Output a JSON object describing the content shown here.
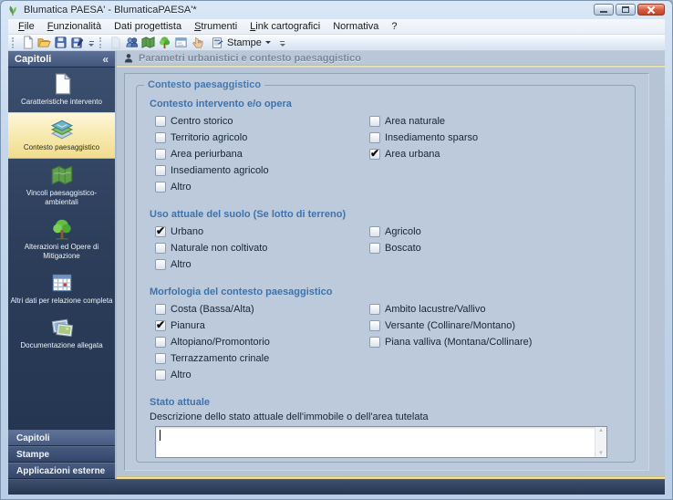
{
  "window": {
    "title": "Blumatica PAESA' - BlumaticaPAESA'*"
  },
  "menubar": {
    "items": [
      "File",
      "Funzionalità",
      "Dati progettista",
      "Strumenti",
      "Link cartografici",
      "Normativa",
      "?"
    ]
  },
  "toolbar": {
    "group1_icons": [
      "new-document-icon",
      "open-folder-icon",
      "save-icon",
      "save-as-icon"
    ],
    "group2_icons": [
      "disabled-document-icon",
      "users-icon",
      "green-map-icon",
      "tree-icon",
      "form-window-icon",
      "hand-icon"
    ],
    "stampe_label": "Stampe"
  },
  "sidebar": {
    "header": "Capitoli",
    "collapse_glyph": "«",
    "items": [
      {
        "label": "Caratteristiche intervento",
        "icon": "document-icon",
        "selected": false
      },
      {
        "label": "Contesto paesaggistico",
        "icon": "map-layers-icon",
        "selected": true
      },
      {
        "label": "Vincoli paesaggistico-ambientali",
        "icon": "green-map-icon",
        "selected": false
      },
      {
        "label": "Alterazioni ed Opere di Mitigazione",
        "icon": "tree-icon",
        "selected": false
      },
      {
        "label": "Altri dati per relazione completa",
        "icon": "table-icon",
        "selected": false
      },
      {
        "label": "Documentazione allegata",
        "icon": "photos-icon",
        "selected": false
      }
    ],
    "bottom_nav": [
      "Capitoli",
      "Stampe",
      "Applicazioni esterne"
    ]
  },
  "main": {
    "header_title": "Parametri urbanistici e contesto paesaggistico",
    "header_icon": "person-icon",
    "groupbox_title": "Contesto paesaggistico",
    "sections": [
      {
        "title": "Contesto intervento e/o opera",
        "rows": [
          {
            "left": {
              "label": "Centro storico",
              "checked": false
            },
            "right": {
              "label": "Area naturale",
              "checked": false
            }
          },
          {
            "left": {
              "label": "Territorio agricolo",
              "checked": false
            },
            "right": {
              "label": "Insediamento sparso",
              "checked": false
            }
          },
          {
            "left": {
              "label": "Area periurbana",
              "checked": false
            },
            "right": {
              "label": "Area urbana",
              "checked": true
            }
          },
          {
            "left": {
              "label": "Insediamento agricolo",
              "checked": false
            }
          },
          {
            "left": {
              "label": "Altro",
              "checked": false
            }
          }
        ]
      },
      {
        "title": "Uso attuale del suolo (Se lotto di terreno)",
        "rows": [
          {
            "left": {
              "label": "Urbano",
              "checked": true
            },
            "right": {
              "label": "Agricolo",
              "checked": false
            }
          },
          {
            "left": {
              "label": "Naturale non coltivato",
              "checked": false
            },
            "right": {
              "label": "Boscato",
              "checked": false
            }
          },
          {
            "left": {
              "label": "Altro",
              "checked": false
            }
          }
        ]
      },
      {
        "title": "Morfologia del contesto paesaggistico",
        "rows": [
          {
            "left": {
              "label": "Costa (Bassa/Alta)",
              "checked": false
            },
            "right": {
              "label": "Ambito lacustre/Vallivo",
              "checked": false
            }
          },
          {
            "left": {
              "label": "Pianura",
              "checked": true
            },
            "right": {
              "label": "Versante (Collinare/Montano)",
              "checked": false
            }
          },
          {
            "left": {
              "label": "Altopiano/Promontorio",
              "checked": false
            },
            "right": {
              "label": "Piana valliva (Montana/Collinare)",
              "checked": false
            }
          },
          {
            "left": {
              "label": "Terrazzamento crinale",
              "checked": false
            }
          },
          {
            "left": {
              "label": "Altro",
              "checked": false
            }
          }
        ]
      }
    ],
    "stato_attuale": {
      "title": "Stato attuale",
      "description_label": "Descrizione dello stato attuale dell'immobile o dell'area tutelata",
      "textarea_value": ""
    }
  },
  "colors": {
    "sidebar_navy": "#2c3e5a",
    "selected_item_cream": "#f6e7a6",
    "accent_gold": "#e5d48d",
    "heading_blue": "#3d73ad",
    "statusbar_navy": "#2c3d59",
    "close_button_red": "#d4593c"
  }
}
